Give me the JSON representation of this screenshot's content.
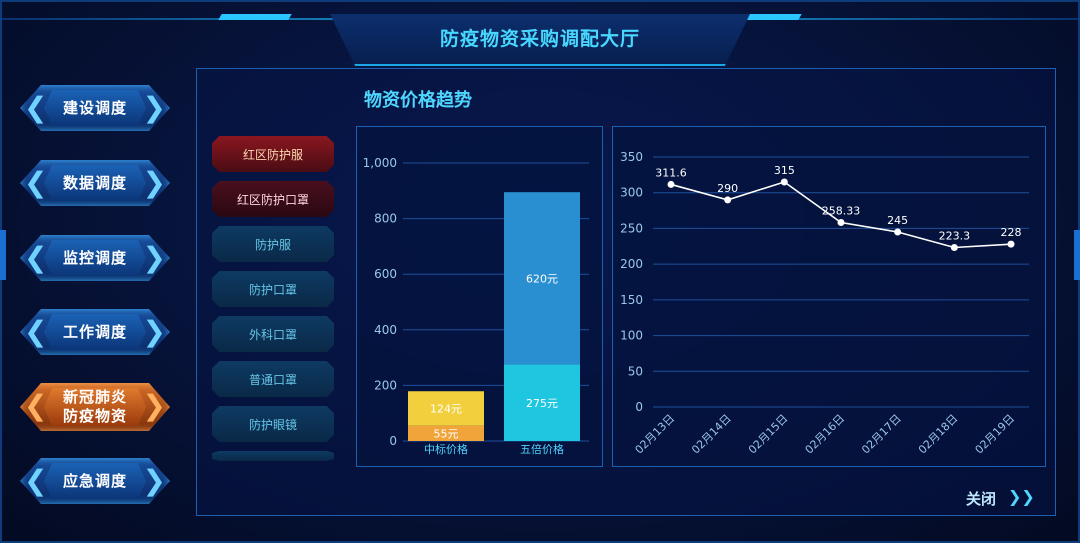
{
  "header": {
    "title": "防疫物资采购调配大厅"
  },
  "sidebar": {
    "items": [
      {
        "label": "建设调度"
      },
      {
        "label": "数据调度"
      },
      {
        "label": "监控调度"
      },
      {
        "label": "工作调度"
      },
      {
        "label": "新冠肺炎\n防疫物资",
        "active": true
      },
      {
        "label": "应急调度"
      }
    ]
  },
  "main": {
    "title": "物资价格趋势",
    "categories": [
      {
        "label": "红区防护服",
        "style": "red"
      },
      {
        "label": "红区防护口罩",
        "style": "dark-red"
      },
      {
        "label": "防护服"
      },
      {
        "label": "防护口罩"
      },
      {
        "label": "外科口罩"
      },
      {
        "label": "普通口罩"
      },
      {
        "label": "防护眼镜"
      }
    ],
    "close_label": "关闭"
  },
  "colors": {
    "accent": "#4fd6ff",
    "bar_bottom_1": "#f0a43a",
    "bar_top_1": "#f2cf3c",
    "bar_bottom_2": "#1ec6e0",
    "bar_top_2": "#2a8fd0",
    "line": "#ffffff"
  },
  "chart_data": [
    {
      "type": "bar",
      "stacked": true,
      "categories": [
        "中标价格",
        "五倍价格"
      ],
      "series": [
        {
          "values": [
            55,
            275
          ],
          "labels": [
            "55元",
            "275元"
          ]
        },
        {
          "values": [
            124,
            620
          ],
          "labels": [
            "124元",
            "620元"
          ]
        }
      ],
      "yticks": [
        "0",
        "200",
        "400",
        "600",
        "800",
        "1,000"
      ],
      "ylim": [
        0,
        1000
      ],
      "grid": true
    },
    {
      "type": "line",
      "x": [
        "02月13日",
        "02月14日",
        "02月15日",
        "02月16日",
        "02月17日",
        "02月18日",
        "02月19日"
      ],
      "values": [
        311.6,
        290,
        315,
        258.33,
        245,
        223.3,
        228
      ],
      "labels": [
        "311.6",
        "290",
        "315",
        "258.33",
        "245",
        "223.3",
        "228"
      ],
      "yticks": [
        "0",
        "50",
        "100",
        "150",
        "200",
        "250",
        "300",
        "350"
      ],
      "ylim": [
        0,
        350
      ],
      "grid": true
    }
  ]
}
